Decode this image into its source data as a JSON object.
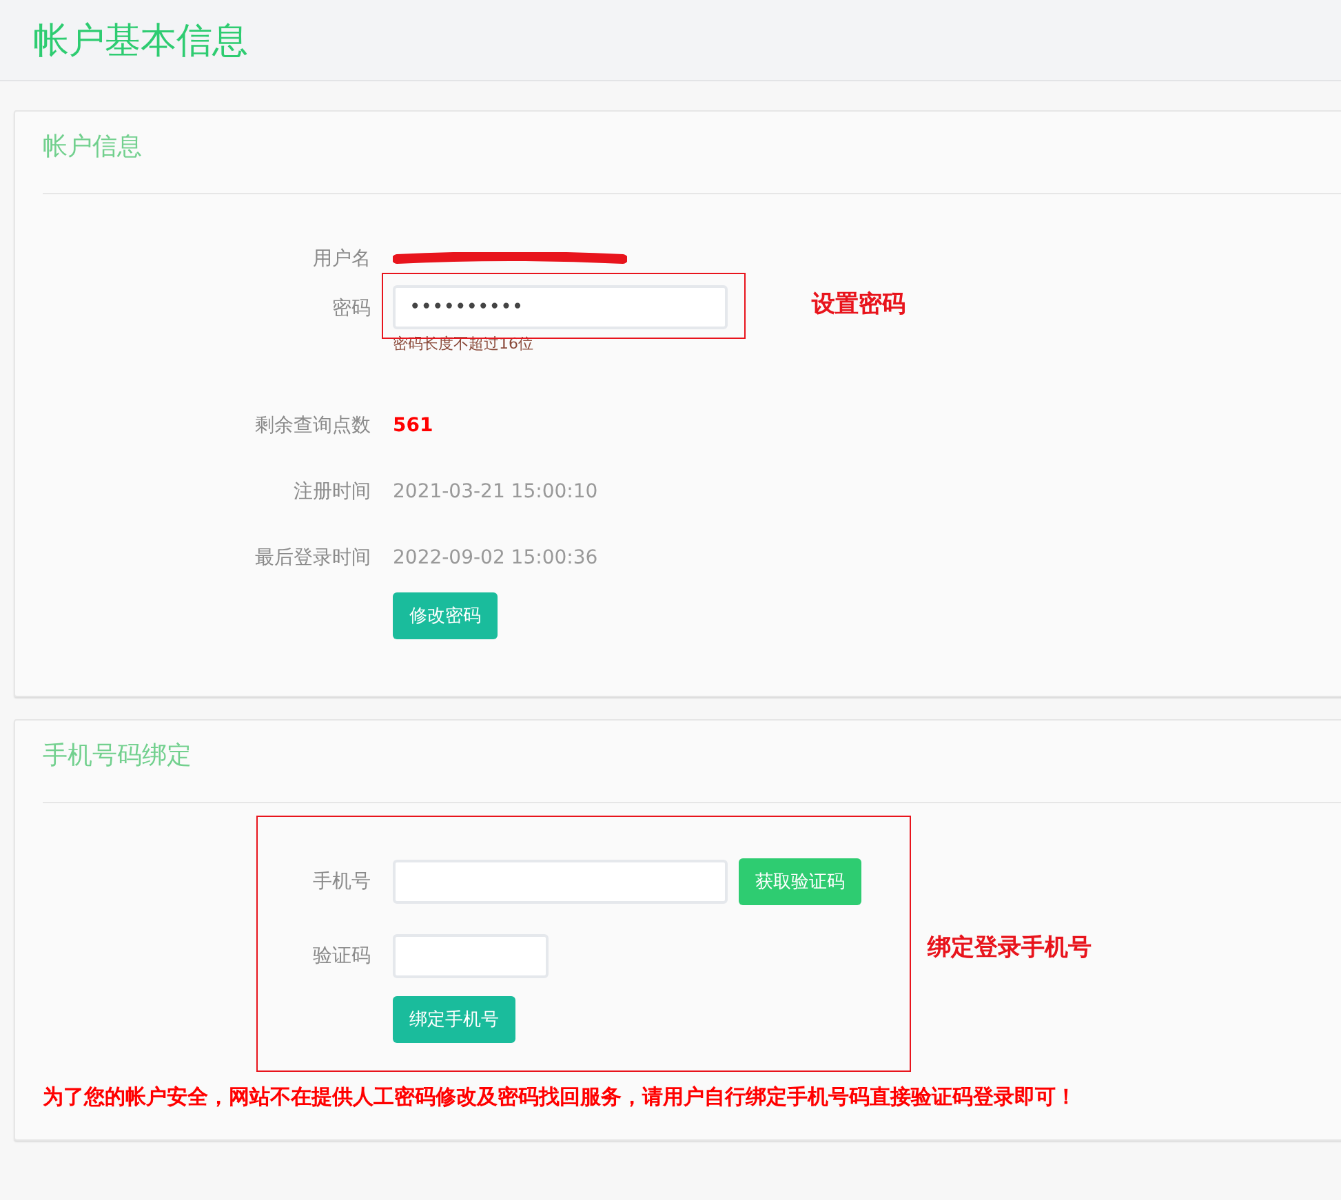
{
  "page_title": "帐户基本信息",
  "account_card": {
    "title": "帐户信息",
    "username": {
      "label": "用户名",
      "redacted": true
    },
    "password": {
      "label": "密码",
      "value": "••••••••••",
      "hint": "密码长度不超过16位",
      "annotation": "设置密码"
    },
    "rows": [
      {
        "label": "剩余查询点数",
        "value": "561",
        "kind": "highlight"
      },
      {
        "label": "注册时间",
        "value": "2021-03-21 15:00:10",
        "kind": "plain"
      },
      {
        "label": "最后登录时间",
        "value": "2022-09-02 15:00:36",
        "kind": "plain"
      }
    ],
    "button": "修改密码"
  },
  "phone_card": {
    "title": "手机号码绑定",
    "phone": {
      "label": "手机号",
      "button": "获取验证码"
    },
    "code": {
      "label": "验证码"
    },
    "button": "绑定手机号",
    "annotation": "绑定登录手机号",
    "notice": "为了您的帐户安全，网站不在提供人工密码修改及密码找回服务，请用户自行绑定手机号码直接验证码登录即可！"
  }
}
